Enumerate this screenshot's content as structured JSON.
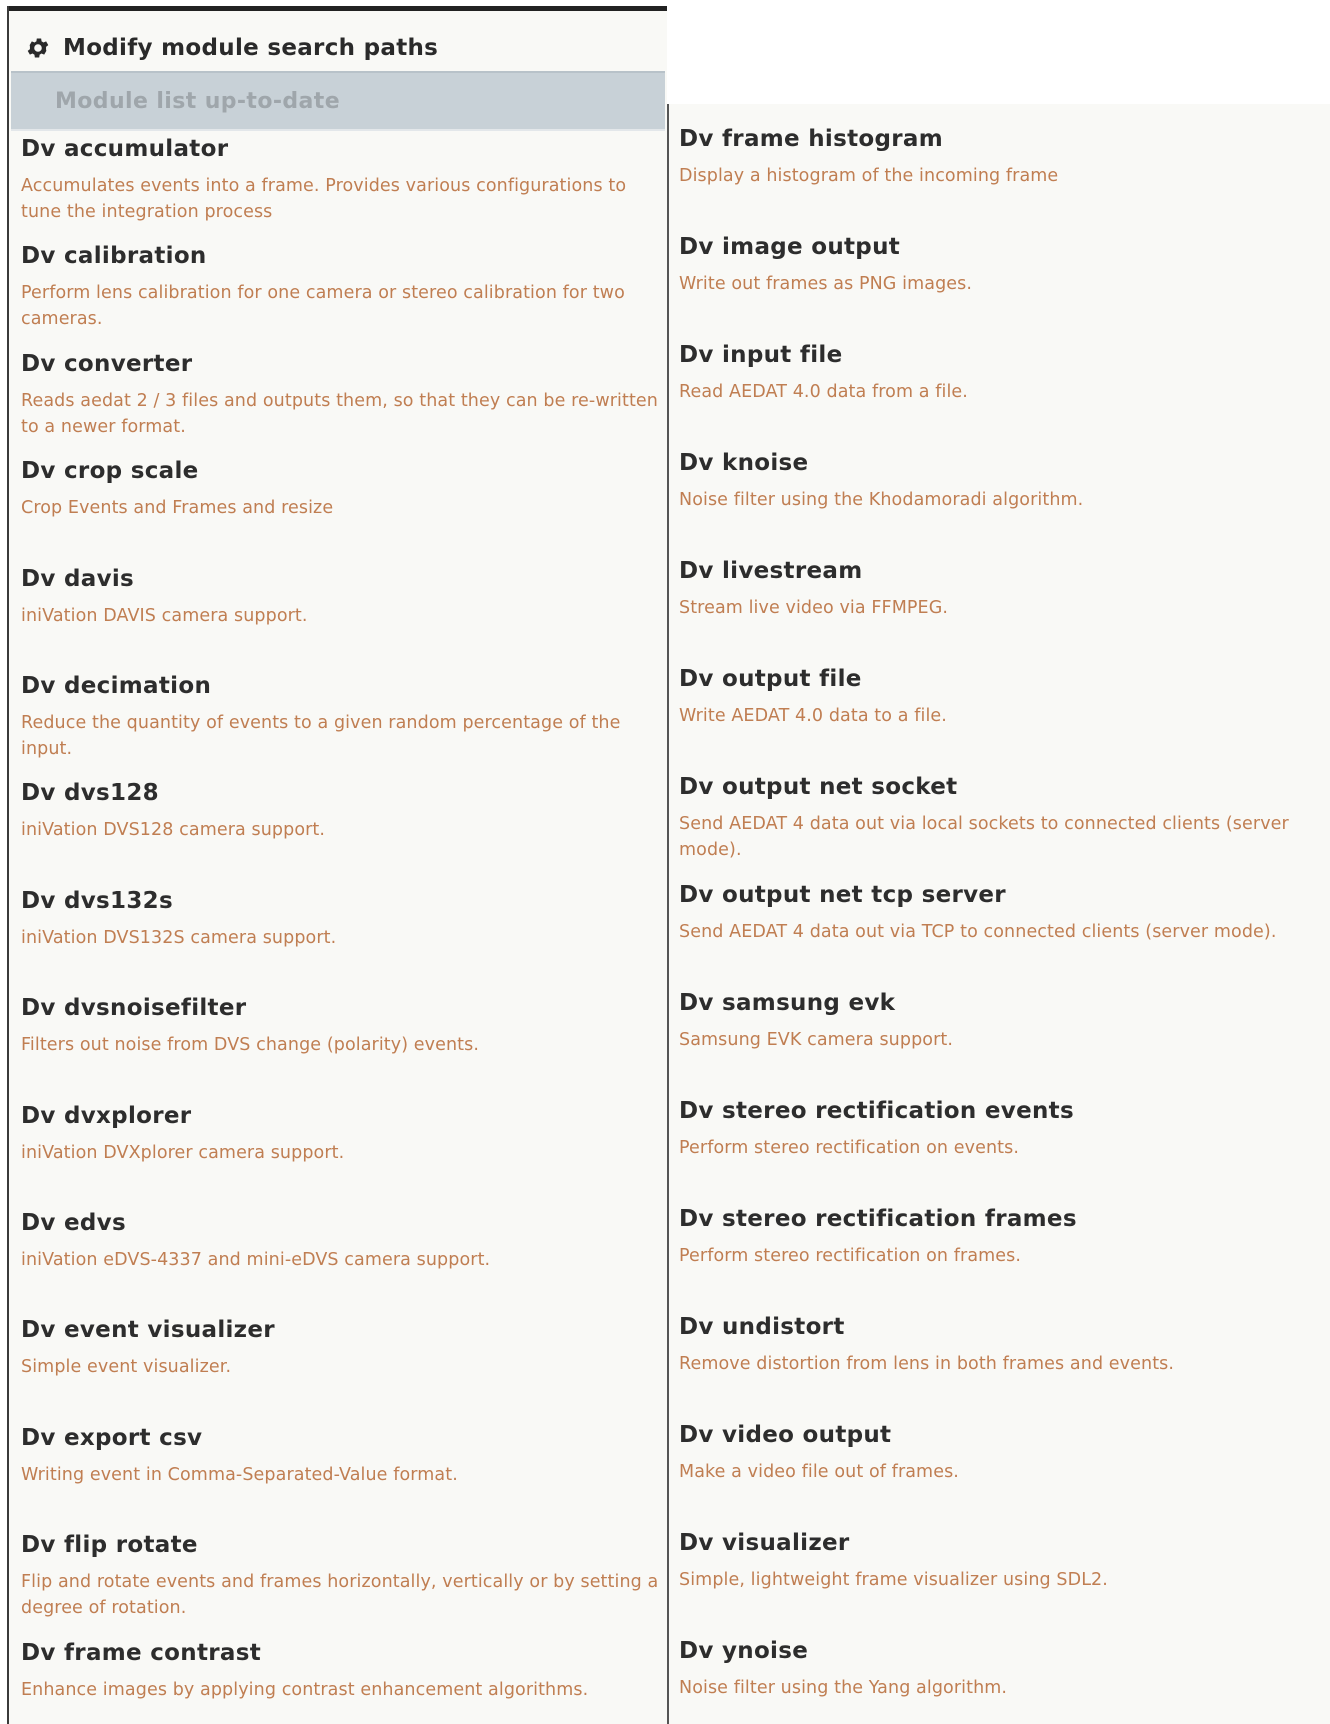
{
  "header": {
    "search_paths_label": "Modify module search paths",
    "status": "Module list up-to-date"
  },
  "modules_left": [
    {
      "name": "Dv accumulator",
      "desc": "Accumulates events into a frame. Provides various configurations to tune the integration process"
    },
    {
      "name": "Dv calibration",
      "desc": "Perform lens calibration for one camera or stereo calibration for two cameras."
    },
    {
      "name": "Dv converter",
      "desc": "Reads aedat 2 / 3 files and outputs them, so that they can be re-written to a newer format."
    },
    {
      "name": "Dv crop scale",
      "desc": "Crop Events and Frames and resize"
    },
    {
      "name": "Dv davis",
      "desc": "iniVation DAVIS camera support."
    },
    {
      "name": "Dv decimation",
      "desc": "Reduce the quantity of events to a given random percentage of the input."
    },
    {
      "name": "Dv dvs128",
      "desc": "iniVation DVS128 camera support."
    },
    {
      "name": "Dv dvs132s",
      "desc": "iniVation DVS132S camera support."
    },
    {
      "name": "Dv dvsnoisefilter",
      "desc": "Filters out noise from DVS change (polarity) events."
    },
    {
      "name": "Dv dvxplorer",
      "desc": "iniVation DVXplorer camera support."
    },
    {
      "name": "Dv edvs",
      "desc": "iniVation eDVS-4337 and mini-eDVS camera support."
    },
    {
      "name": "Dv event visualizer",
      "desc": "Simple event visualizer."
    },
    {
      "name": "Dv export csv",
      "desc": "Writing event in Comma-Separated-Value format."
    },
    {
      "name": "Dv flip rotate",
      "desc": "Flip and rotate events and frames horizontally, vertically or by setting a degree of rotation."
    },
    {
      "name": "Dv frame contrast",
      "desc": "Enhance images by applying contrast enhancement algorithms."
    }
  ],
  "modules_right": [
    {
      "name": "Dv frame histogram",
      "desc": "Display a histogram of the incoming frame"
    },
    {
      "name": "Dv image output",
      "desc": "Write out frames as PNG images."
    },
    {
      "name": "Dv input file",
      "desc": "Read AEDAT 4.0 data from a file."
    },
    {
      "name": "Dv knoise",
      "desc": "Noise filter using the Khodamoradi algorithm."
    },
    {
      "name": "Dv livestream",
      "desc": "Stream live video via FFMPEG."
    },
    {
      "name": "Dv output file",
      "desc": "Write AEDAT 4.0 data to a file."
    },
    {
      "name": "Dv output net socket",
      "desc": "Send AEDAT 4 data out via local sockets to connected clients (server mode)."
    },
    {
      "name": "Dv output net tcp server",
      "desc": "Send AEDAT 4 data out via TCP to connected clients (server mode)."
    },
    {
      "name": "Dv samsung evk",
      "desc": "Samsung EVK camera support."
    },
    {
      "name": "Dv stereo rectification events",
      "desc": "Perform stereo rectification on events."
    },
    {
      "name": "Dv stereo rectification frames",
      "desc": "Perform stereo rectification on frames."
    },
    {
      "name": "Dv undistort",
      "desc": "Remove distortion from lens in both frames and events."
    },
    {
      "name": "Dv video output",
      "desc": "Make a video file out of frames."
    },
    {
      "name": "Dv visualizer",
      "desc": "Simple, lightweight frame visualizer using SDL2."
    },
    {
      "name": "Dv ynoise",
      "desc": "Noise filter using the Yang algorithm."
    }
  ]
}
